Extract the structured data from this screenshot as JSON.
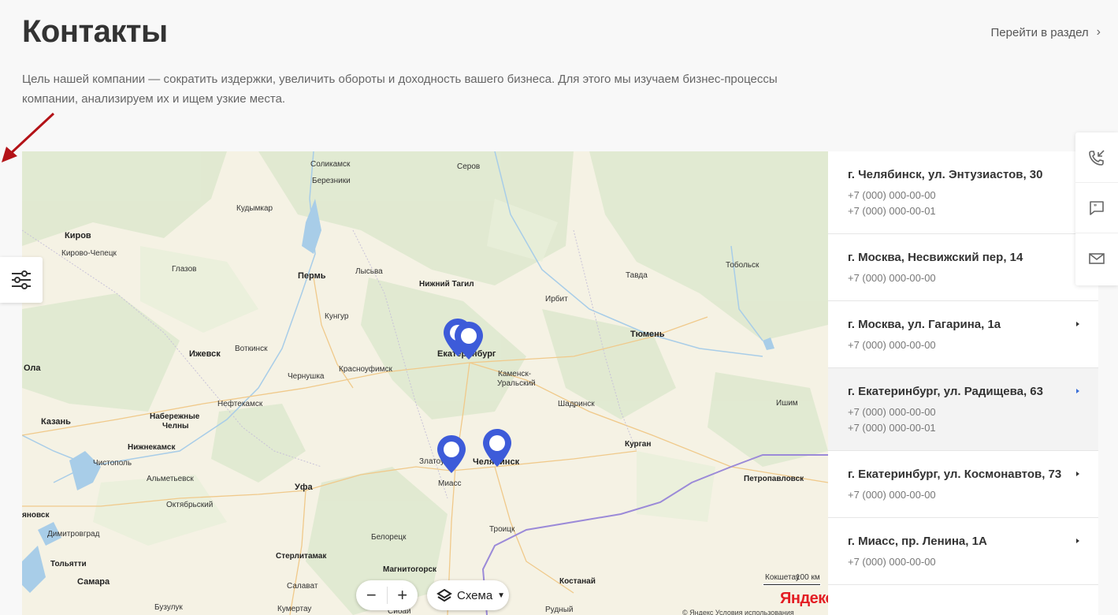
{
  "header": {
    "title": "Контакты",
    "goto_label": "Перейти в раздел",
    "intro": "Цель нашей компании — сократить издержки, увеличить обороты и доходность вашего бизнеса. Для этого мы изучаем бизнес-процессы компании, анализируем их и ищем узкие места."
  },
  "map": {
    "cities": [
      {
        "name": "Соликамск",
        "big": false
      },
      {
        "name": "Серов",
        "big": false
      },
      {
        "name": "Березники",
        "big": false
      },
      {
        "name": "Кудымкар",
        "big": false
      },
      {
        "name": "Киров",
        "big": true
      },
      {
        "name": "Кирово-Чепецк",
        "big": false
      },
      {
        "name": "Глазов",
        "big": false
      },
      {
        "name": "Пермь",
        "big": true
      },
      {
        "name": "Лысьва",
        "big": false
      },
      {
        "name": "Нижний Тагил",
        "big": true
      },
      {
        "name": "Тавда",
        "big": false
      },
      {
        "name": "Тобольск",
        "big": false
      },
      {
        "name": "Ирбит",
        "big": false
      },
      {
        "name": "Кунгур",
        "big": false
      },
      {
        "name": "Ижевск",
        "big": true
      },
      {
        "name": "Воткинск",
        "big": false
      },
      {
        "name": "Екатеринбург",
        "big": true
      },
      {
        "name": "Тюмень",
        "big": true
      },
      {
        "name": "Ола",
        "big": true
      },
      {
        "name": "Чернушка",
        "big": false
      },
      {
        "name": "Красноуфимск",
        "big": false
      },
      {
        "name": "Каменск-",
        "big": false
      },
      {
        "name": "Уральский",
        "big": false
      },
      {
        "name": "Нефтекамск",
        "big": false
      },
      {
        "name": "Шадринск",
        "big": false
      },
      {
        "name": "Ишим",
        "big": false
      },
      {
        "name": "Казань",
        "big": true
      },
      {
        "name": "Набережные",
        "big": true
      },
      {
        "name": "Челны",
        "big": true
      },
      {
        "name": "Нижнекамск",
        "big": true
      },
      {
        "name": "Курган",
        "big": true
      },
      {
        "name": "Чистополь",
        "big": false
      },
      {
        "name": "Златоуст",
        "big": false
      },
      {
        "name": "Челябинск",
        "big": true
      },
      {
        "name": "Альметьевск",
        "big": false
      },
      {
        "name": "Миасс",
        "big": false
      },
      {
        "name": "Петропавловск",
        "big": true
      },
      {
        "name": "Уфа",
        "big": true
      },
      {
        "name": "Октябрьский",
        "big": false
      },
      {
        "name": "Троицк",
        "big": false
      },
      {
        "name": "яновск",
        "big": true
      },
      {
        "name": "Димитровград",
        "big": false
      },
      {
        "name": "Белорецк",
        "big": false
      },
      {
        "name": "Стерлитамак",
        "big": true
      },
      {
        "name": "Тольятти",
        "big": true
      },
      {
        "name": "Магнитогорск",
        "big": true
      },
      {
        "name": "Самара",
        "big": true
      },
      {
        "name": "Салават",
        "big": false
      },
      {
        "name": "Костанай",
        "big": true
      },
      {
        "name": "Кокшетау",
        "big": false
      },
      {
        "name": "Бузулук",
        "big": false
      },
      {
        "name": "Кумертау",
        "big": false
      },
      {
        "name": "Сибай",
        "big": false
      },
      {
        "name": "Рудный",
        "big": false
      }
    ],
    "controls": {
      "zoom_out": "−",
      "zoom_in": "+",
      "layers_label": "Схема",
      "scale_label": "100 км",
      "logo": "Яндекс",
      "copyright": "© Яндекс  Условия использования"
    },
    "pin_color": "#3d5bd9"
  },
  "contacts": [
    {
      "address": "г. Челябинск, ул. Энтузиастов, 30",
      "phones": [
        "+7 (000) 000-00-00",
        "+7 (000) 000-00-01"
      ],
      "arrow": false,
      "active": false
    },
    {
      "address": "г. Москва, Несвижский пер, 14",
      "phones": [
        "+7 (000) 000-00-00"
      ],
      "arrow": false,
      "active": false
    },
    {
      "address": "г. Москва, ул. Гагарина, 1а",
      "phones": [
        "+7 (000) 000-00-00"
      ],
      "arrow": true,
      "active": false
    },
    {
      "address": "г. Екатеринбург, ул. Радищева, 63",
      "phones": [
        "+7 (000) 000-00-00",
        "+7 (000) 000-00-01"
      ],
      "arrow": true,
      "active": true
    },
    {
      "address": "г. Екатеринбург, ул. Космонавтов, 73",
      "phones": [
        "+7 (000) 000-00-00"
      ],
      "arrow": true,
      "active": false
    },
    {
      "address": "г. Миасс, пр. Ленина, 1А",
      "phones": [
        "+7 (000) 000-00-00"
      ],
      "arrow": true,
      "active": false
    }
  ],
  "sidepanel": {
    "icons": [
      "callback-icon",
      "chat-icon",
      "mail-icon"
    ]
  }
}
